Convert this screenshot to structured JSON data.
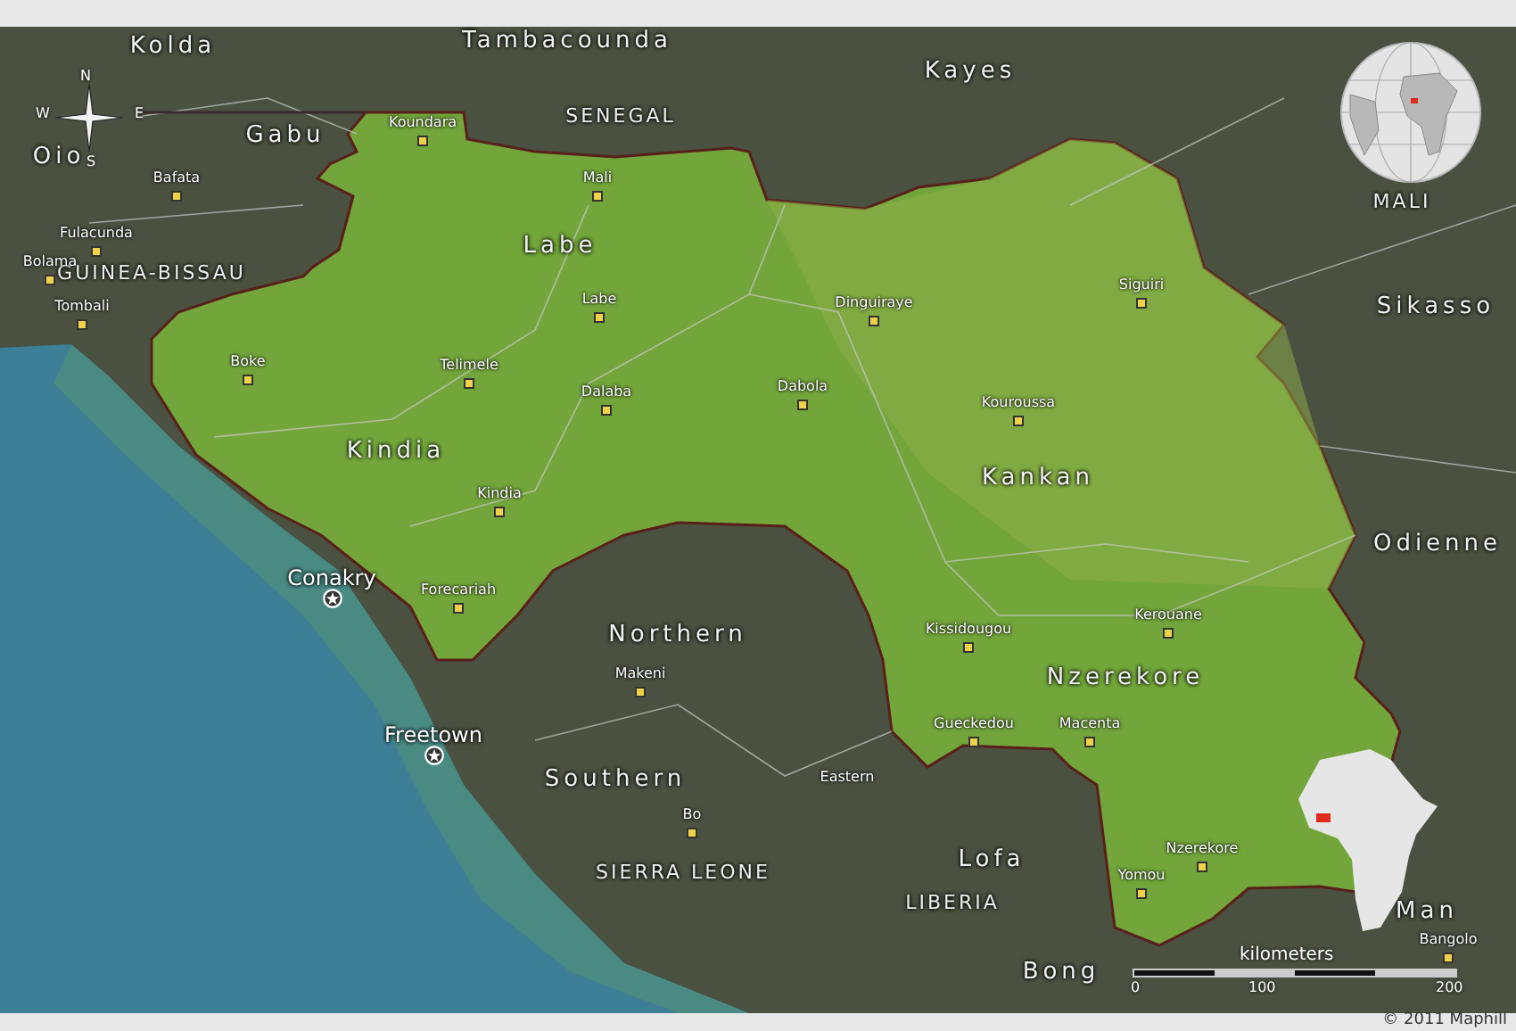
{
  "map": {
    "labels": [
      {
        "text": "Kolda",
        "kind": "region"
      },
      {
        "text": "Tambacounda",
        "kind": "region"
      },
      {
        "text": "SENEGAL",
        "kind": "country"
      },
      {
        "text": "Gabu",
        "kind": "region"
      },
      {
        "text": "Oio",
        "kind": "region"
      },
      {
        "text": "Kayes",
        "kind": "region"
      },
      {
        "text": "MALI",
        "kind": "country"
      },
      {
        "text": "Sikasso",
        "kind": "region"
      },
      {
        "text": "Labe",
        "kind": "region"
      },
      {
        "text": "Kindia",
        "kind": "region"
      },
      {
        "text": "Kankan",
        "kind": "region"
      },
      {
        "text": "Odienne",
        "kind": "region"
      },
      {
        "text": "Northern",
        "kind": "region"
      },
      {
        "text": "Nzerekore",
        "kind": "region"
      },
      {
        "text": "Southern",
        "kind": "region"
      },
      {
        "text": "Eastern",
        "kind": "city"
      },
      {
        "text": "Lofa",
        "kind": "region"
      },
      {
        "text": "LIBERIA",
        "kind": "country"
      },
      {
        "text": "Bong",
        "kind": "region"
      },
      {
        "text": "Man",
        "kind": "region"
      },
      {
        "text": "SIERRA LEONE",
        "kind": "country"
      },
      {
        "text": "GUINEA-BISSAU",
        "kind": "country"
      },
      {
        "text": "Koundara",
        "kind": "city"
      },
      {
        "text": "Bafata",
        "kind": "city"
      },
      {
        "text": "Fulacunda",
        "kind": "city"
      },
      {
        "text": "Bolama",
        "kind": "city"
      },
      {
        "text": "Tombali",
        "kind": "city"
      },
      {
        "text": "Mali",
        "kind": "city"
      },
      {
        "text": "Labe",
        "kind": "city"
      },
      {
        "text": "Boke",
        "kind": "city"
      },
      {
        "text": "Telimele",
        "kind": "city"
      },
      {
        "text": "Dalaba",
        "kind": "city"
      },
      {
        "text": "Kindia",
        "kind": "city"
      },
      {
        "text": "Forecariah",
        "kind": "city"
      },
      {
        "text": "Conakry",
        "kind": "capital"
      },
      {
        "text": "Freetown",
        "kind": "capital"
      },
      {
        "text": "Makeni",
        "kind": "city"
      },
      {
        "text": "Bo",
        "kind": "city"
      },
      {
        "text": "Dinguiraye",
        "kind": "city"
      },
      {
        "text": "Siguiri",
        "kind": "city"
      },
      {
        "text": "Dabola",
        "kind": "city"
      },
      {
        "text": "Kouroussa",
        "kind": "city"
      },
      {
        "text": "Kerouane",
        "kind": "city"
      },
      {
        "text": "Kissidougou",
        "kind": "city"
      },
      {
        "text": "Gueckedou",
        "kind": "city"
      },
      {
        "text": "Macenta",
        "kind": "city"
      },
      {
        "text": "Nzerekore",
        "kind": "city"
      },
      {
        "text": "Yomou",
        "kind": "city"
      },
      {
        "text": "Bangolo",
        "kind": "city"
      }
    ]
  },
  "compass": {
    "north": "N",
    "east": "E",
    "south": "S",
    "west": "W"
  },
  "scale_bar": {
    "unit": "kilometers",
    "ticks": [
      "0",
      "100",
      "200"
    ]
  },
  "copyright": "© 2011 Maphill"
}
